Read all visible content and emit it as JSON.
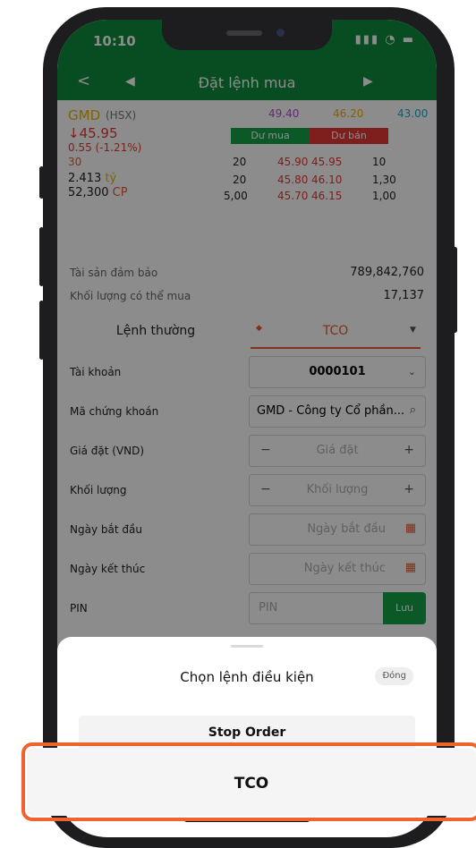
{
  "status": {
    "time": "10:10",
    "icons": "signal-wifi-battery-icons",
    "icons_text": "▮▮▮ ◔ ▬"
  },
  "nav": {
    "back": "<",
    "prev": "◀",
    "title": "Đặt lệnh mua",
    "next": "▶"
  },
  "quote": {
    "symbol": "GMD",
    "exchange": "(HSX)",
    "ceiling": "49.40",
    "reference": "46.20",
    "floor": "43.00",
    "price": "45.95",
    "change": "0.55 (-1.21%)",
    "volume_small": "30",
    "value": "2.413",
    "value_unit": "tỷ",
    "shares": "52,300",
    "shares_unit": "CP",
    "bid_label": "Dư mua",
    "ask_label": "Dư bán",
    "book": [
      {
        "bid_qty": "20",
        "bid": "45.90",
        "ask": "45.95",
        "ask_qty": "10"
      },
      {
        "bid_qty": "20",
        "bid": "45.80",
        "ask": "46.10",
        "ask_qty": "1,30"
      },
      {
        "bid_qty": "5,00",
        "bid": "45.70",
        "ask": "46.15",
        "ask_qty": "1,00"
      }
    ]
  },
  "account_info": {
    "collateral_label": "Tài sản đảm bảo",
    "collateral_value": "789,842,760",
    "buyable_label": "Khối lượng có thể mua",
    "buyable_value": "17,137"
  },
  "tabs": {
    "normal": "Lệnh thường",
    "conditional": "TCO"
  },
  "form": {
    "account_label": "Tài khoản",
    "account_value": "0000101",
    "symbol_label": "Mã chứng khoán",
    "symbol_value": "GMD - Công ty Cổ phần...",
    "price_label": "Giá đặt (VND)",
    "price_placeholder": "Giá đặt",
    "qty_label": "Khối lượng",
    "qty_placeholder": "Khối lượng",
    "start_label": "Ngày bắt đầu",
    "start_placeholder": "Ngày bắt đầu",
    "end_label": "Ngày kết thúc",
    "end_placeholder": "Ngày kết thúc",
    "pin_label": "PIN",
    "pin_placeholder": "PIN",
    "save_label": "Lưu"
  },
  "sheet": {
    "title": "Chọn lệnh điều kiện",
    "close_label": "Đóng",
    "options": [
      "Stop Order",
      "TCO"
    ]
  },
  "colors": {
    "brand_green": "#0f8a3d",
    "accent_orange": "#f0622e",
    "up": "#17a24a",
    "down": "#e53935",
    "ceiling": "#b24bd1",
    "reference": "#e8b400",
    "floor": "#1aa6d6"
  }
}
